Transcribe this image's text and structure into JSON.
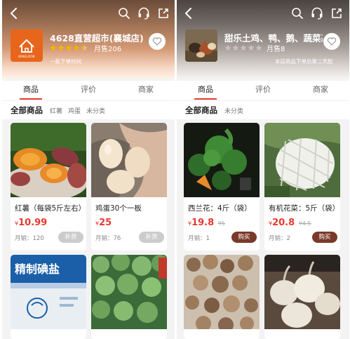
{
  "left": {
    "store_name": "4628直营超市(襄城店)",
    "logo_text": "KINGLOOK",
    "rating_stars": 4.5,
    "sold": "月售206",
    "note": "一批下单时间",
    "tabs": [
      "商品",
      "评价",
      "商家"
    ],
    "categories_title": "全部商品",
    "categories": [
      "红薯",
      "鸡蛋",
      "未分类"
    ],
    "products": [
      {
        "name": "红薯（每袋5斤左右）",
        "currency": "¥",
        "price": "10.99",
        "original_price": "",
        "monthly": "月销：120",
        "button": "补货"
      },
      {
        "name": "鸡蛋30个一板",
        "currency": "¥",
        "price": "25",
        "original_price": "",
        "monthly": "月销：76",
        "button": "补货"
      }
    ],
    "bottom_card_text": "精制碘盐"
  },
  "right": {
    "store_name": "甜乐土鸡、鸭、鹅、蔬菜基地",
    "rating_stars": 0,
    "sold": "月售8",
    "note": "本店商品下单后第二天配",
    "tabs": [
      "商品",
      "评价",
      "商家"
    ],
    "categories_title": "全部商品",
    "categories": [
      "未分类"
    ],
    "products": [
      {
        "name": "西兰花：4斤（袋）",
        "currency": "¥",
        "price": "19.8",
        "original_price": "¥5",
        "monthly": "月销：1",
        "button": "购买"
      },
      {
        "name": "有机花菜：5斤（袋）",
        "currency": "¥",
        "price": "20.8",
        "original_price": "¥4.5",
        "monthly": "月销：2",
        "button": "购买"
      }
    ]
  },
  "colors": {
    "accent_red": "#e8382f",
    "buy_button": "#7a3a2a",
    "restock_button": "#cccccc",
    "logo_orange": "#e8651c"
  },
  "icons": [
    "back-icon",
    "search-icon",
    "headset-icon",
    "share-icon",
    "heart-icon",
    "star-icon"
  ]
}
